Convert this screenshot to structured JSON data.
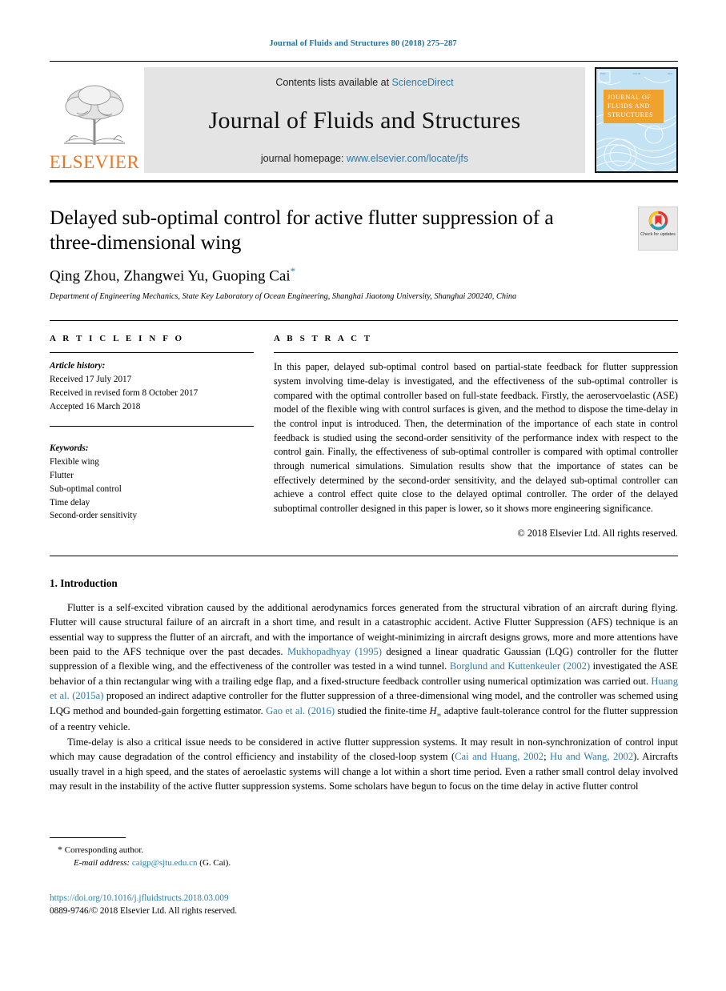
{
  "running_head": "Journal of Fluids and Structures 80 (2018) 275–287",
  "masthead": {
    "publisher": "ELSEVIER",
    "contents_prefix": "Contents lists available at ",
    "contents_link": "ScienceDirect",
    "journal_name": "Journal of Fluids and Structures",
    "homepage_prefix": "journal homepage: ",
    "homepage_link": "www.elsevier.com/locate/jfs",
    "cover_title": "JOURNAL OF FLUIDS AND STRUCTURES"
  },
  "article": {
    "title": "Delayed sub-optimal control for active flutter suppression of a three-dimensional wing",
    "authors": "Qing Zhou, Zhangwei Yu, Guoping Cai",
    "corresponding_marker": "*",
    "affiliation": "Department of Engineering Mechanics, State Key Laboratory of Ocean Engineering, Shanghai Jiaotong University, Shanghai 200240, China",
    "crossmark_label": "Check for updates"
  },
  "info": {
    "heading": "A R T I C L E   I N F O",
    "history_label": "Article history:",
    "received": "Received 17 July 2017",
    "revised": "Received in revised form 8 October 2017",
    "accepted": "Accepted 16 March 2018",
    "keywords_label": "Keywords:",
    "keywords": [
      "Flexible wing",
      "Flutter",
      "Sub-optimal control",
      "Time delay",
      "Second-order sensitivity"
    ]
  },
  "abstract": {
    "heading": "A B S T R A C T",
    "text": "In this paper, delayed sub-optimal control based on partial-state feedback for flutter suppression system involving time-delay is investigated, and the effectiveness of the sub-optimal controller is compared with the optimal controller based on full-state feedback. Firstly, the aeroservoelastic (ASE) model of the flexible wing with control surfaces is given, and the method to dispose the time-delay in the control input is introduced. Then, the determination of the importance of each state in control feedback is studied using the second-order sensitivity of the performance index with respect to the control gain. Finally, the effectiveness of sub-optimal controller is compared with optimal controller through numerical simulations. Simulation results show that the importance of states can be effectively determined by the second-order sensitivity, and the delayed sub-optimal controller can achieve a control effect quite close to the delayed optimal controller. The order of the delayed suboptimal controller designed in this paper is lower, so it shows more engineering significance.",
    "copyright": "© 2018 Elsevier Ltd. All rights reserved."
  },
  "body": {
    "section_heading": "1. Introduction",
    "para1_a": "Flutter is a self-excited vibration caused by the additional aerodynamics forces generated from the structural vibration of an aircraft during flying. Flutter will cause structural failure of an aircraft in a short time, and result in a catastrophic accident. Active Flutter Suppression (AFS) technique is an essential way to suppress the flutter of an aircraft, and with the importance of weight-minimizing in aircraft designs grows, more and more attentions have been paid to the AFS technique over the past decades. ",
    "cite1": "Mukhopadhyay",
    "cite1_year": "(1995)",
    "para1_b": " designed a linear quadratic Gaussian (LQG) controller for the flutter suppression of a flexible wing, and the effectiveness of the controller was tested in a wind tunnel. ",
    "cite2": "Borglund and Kuttenkeuler",
    "cite2_year": "(2002)",
    "para1_c": " investigated the ASE behavior of a thin rectangular wing with a trailing edge flap, and a fixed-structure feedback controller using numerical optimization was carried out. ",
    "cite3": "Huang et al.",
    "cite3_year": "(2015a)",
    "para1_d": " proposed an indirect adaptive controller for the flutter suppression of a three-dimensional wing model, and the controller was schemed using LQG method and  bounded-gain forgetting estimator. ",
    "cite4": "Gao et al.",
    "cite4_year": "(2016)",
    "para1_e": " studied the finite-time ",
    "para1_math": "H",
    "para1_math_sub": "∞",
    "para1_f": " adaptive fault-tolerance control for the flutter suppression of a reentry vehicle.",
    "para2_a": "Time-delay is also a critical issue needs to be considered in active flutter suppression systems. It may result in non-synchronization of control input which may cause degradation of the control efficiency and instability of the closed-loop system (",
    "cite5": "Cai and Huang, 2002",
    "para2_semi": "; ",
    "cite6": "Hu and Wang, 2002",
    "para2_b": "). Aircrafts usually travel in a high speed, and the states of aeroelastic systems will change a lot within a short time period. Even a rather small control delay involved may result in the instability of the active flutter suppression systems. Some scholars have begun to focus on the time delay in active flutter control"
  },
  "footer": {
    "corresponding_star": "*",
    "corresponding_text": "Corresponding author.",
    "email_label": "E-mail address:",
    "email": "caigp@sjtu.edu.cn",
    "email_suffix": " (G. Cai).",
    "doi": "https://doi.org/10.1016/j.jfluidstructs.2018.03.009",
    "issn": "0889-9746/© 2018 Elsevier Ltd. All rights reserved."
  },
  "colors": {
    "link": "#2e7ca8",
    "elsevier_orange": "#e87722",
    "cover_blue": "#bfe0f2"
  }
}
